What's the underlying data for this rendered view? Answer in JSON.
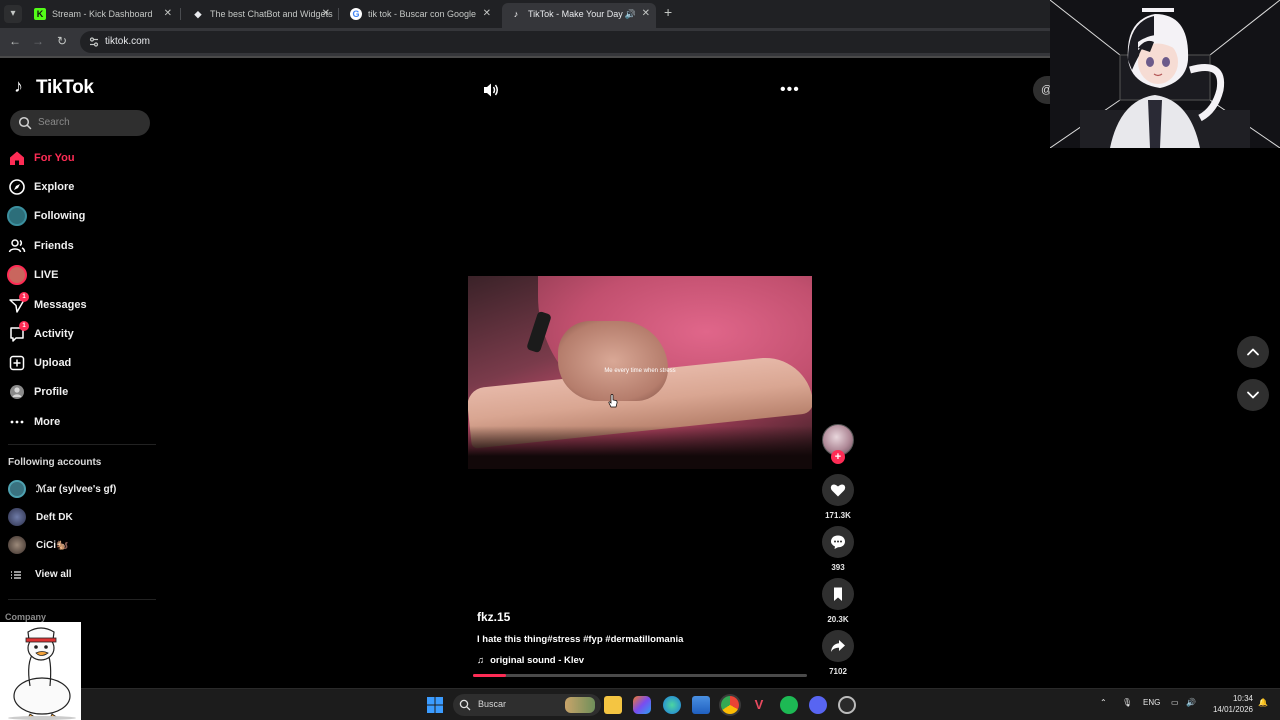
{
  "browser": {
    "tabs": [
      {
        "title": "Stream - Kick Dashboard",
        "favicon": "kick-icon",
        "color": "#53fc18",
        "active": false
      },
      {
        "title": "The best ChatBot and Widgets",
        "favicon": "botrix-icon",
        "color": "#e8eaed",
        "active": false
      },
      {
        "title": "tik tok - Buscar con Google",
        "favicon": "google-icon",
        "color": "#4285f4",
        "active": false
      },
      {
        "title": "TikTok - Make Your Day",
        "favicon": "tiktok-icon",
        "color": "#ffffff",
        "active": true
      }
    ],
    "url": "tiktok.com"
  },
  "brand": {
    "logo_text": "TikTok",
    "accent": "#fe2c55"
  },
  "search": {
    "placeholder": "Search"
  },
  "nav": [
    {
      "label": "For You",
      "icon": "home-icon",
      "active": true
    },
    {
      "label": "Explore",
      "icon": "compass-icon"
    },
    {
      "label": "Following",
      "icon": "following-avatar-icon"
    },
    {
      "label": "Friends",
      "icon": "friends-icon"
    },
    {
      "label": "LIVE",
      "icon": "live-avatar-icon"
    },
    {
      "label": "Messages",
      "icon": "messages-icon",
      "badge": "1"
    },
    {
      "label": "Activity",
      "icon": "activity-icon",
      "badge": "1"
    },
    {
      "label": "Upload",
      "icon": "upload-icon"
    },
    {
      "label": "Profile",
      "icon": "profile-icon"
    },
    {
      "label": "More",
      "icon": "more-icon"
    }
  ],
  "following_accounts": {
    "heading": "Following accounts",
    "items": [
      {
        "name": "ℳar (sylvee's gf)"
      },
      {
        "name": "Deft DK"
      },
      {
        "name": "CiCi🐿️"
      }
    ],
    "view_all": "View all"
  },
  "footer": {
    "company": "Company"
  },
  "video": {
    "overlay_text": "Me every time when stress",
    "username": "fkz.15",
    "description": "I hate this thing#stress #fyp #dermatillomania",
    "sound": "original sound - Klev",
    "progress": 0.1
  },
  "actions": {
    "likes": "171.3K",
    "comments": "393",
    "saves": "20.3K",
    "shares": "7102"
  },
  "taskbar": {
    "search_label": "Buscar",
    "language": "ENG",
    "time": "10:34",
    "date": "14/01/2026"
  }
}
